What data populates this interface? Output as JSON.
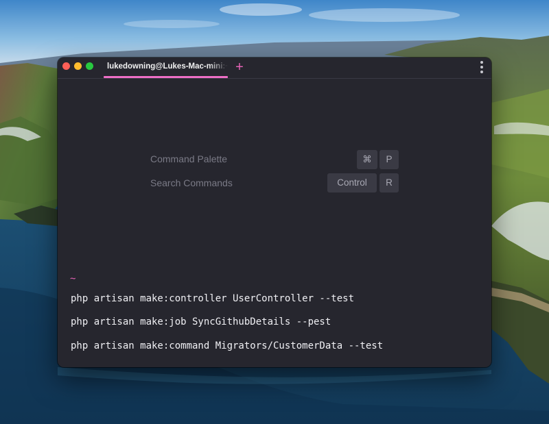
{
  "window": {
    "tab_title": "lukedowning@Lukes-Mac-mini:~",
    "new_tab_label": "+",
    "colors": {
      "accent": "#ee6fc7",
      "prompt": "#e563b6",
      "background": "#26262e"
    },
    "icons": [
      "close-light",
      "minimize-light",
      "zoom-light",
      "plus-icon",
      "vertical-dots-icon"
    ]
  },
  "hints": [
    {
      "label": "Command Palette",
      "keys": [
        "⌘",
        "P"
      ]
    },
    {
      "label": "Search Commands",
      "keys": [
        "Control",
        "R"
      ]
    }
  ],
  "shell": {
    "prompt": "~",
    "commands": [
      "php artisan make:controller UserController --test",
      "php artisan make:job SyncGithubDetails --pest",
      "php artisan make:command Migrators/CustomerData --test"
    ]
  }
}
